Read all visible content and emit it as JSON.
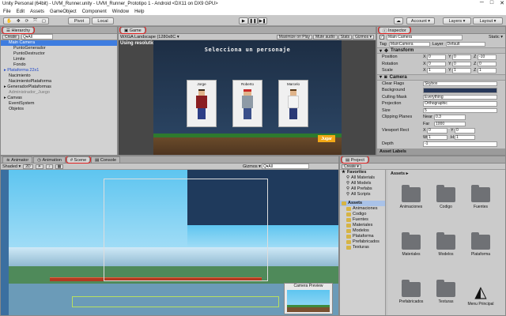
{
  "window": {
    "title": "Unity Personal (64bit) - UVM_Runner.unity - UVM_Runner_Prototipo 1 - Android <DX11 on DX9 GPU>",
    "controls": [
      "─",
      "□",
      "✕"
    ]
  },
  "menu": [
    "File",
    "Edit",
    "Assets",
    "GameObject",
    "Component",
    "Window",
    "Help"
  ],
  "toolbar": {
    "pivot": "Pivot",
    "local": "Local",
    "account": "Account",
    "layers": "Layers",
    "layout": "Layout",
    "cloud": "☁"
  },
  "hierarchy": {
    "tab": "Hierarchy",
    "create": "Create",
    "search": "Q▾All",
    "items": [
      {
        "label": "Main Camera",
        "indent": 1,
        "sel": true
      },
      {
        "label": "PuntoGenerador",
        "indent": 2
      },
      {
        "label": "PuntoDestructor",
        "indent": 2
      },
      {
        "label": "Limite",
        "indent": 2
      },
      {
        "label": "Fondo",
        "indent": 2
      },
      {
        "label": "▸ Plataforma 22x1",
        "indent": 0,
        "blue": true
      },
      {
        "label": "Nacimiento",
        "indent": 1
      },
      {
        "label": "NacimientoPlataforma",
        "indent": 1
      },
      {
        "label": "▸ GeneradorPlataformas",
        "indent": 0
      },
      {
        "label": "Administrador_Juego",
        "indent": 1,
        "gray": true
      },
      {
        "label": "▸ Canvas",
        "indent": 0
      },
      {
        "label": "EventSystem",
        "indent": 1
      },
      {
        "label": "Objetos",
        "indent": 1
      }
    ]
  },
  "game": {
    "tab": "Game",
    "aspect": "WXGA Landscape (1280x8C ▾",
    "options": [
      "Maximize on Play",
      "Mute audio",
      "Stats",
      "Gizmos ▾"
    ],
    "resolution": "Using resolution 531x332",
    "heading": "Selecciona un personaje",
    "chars": [
      "Jorge",
      "Roberto",
      "Marcelo"
    ],
    "button": "Jugar"
  },
  "inspector": {
    "tab": "Inspector",
    "object": "Main Camera",
    "static": "Static ▾",
    "tag_label": "Tag",
    "tag": "MainCamera",
    "layer_label": "Layer",
    "layer": "Default",
    "transform": {
      "title": "Transform",
      "rows": [
        {
          "label": "Position",
          "x": "0",
          "y": "0",
          "z": "-10"
        },
        {
          "label": "Rotation",
          "x": "0",
          "y": "0",
          "z": "0"
        },
        {
          "label": "Scale",
          "x": "1",
          "y": "1",
          "z": "1"
        }
      ]
    },
    "camera": {
      "title": "Camera",
      "clear_flags_label": "Clear Flags",
      "clear_flags": "Skybox",
      "background_label": "Background",
      "culling_label": "Culling Mask",
      "culling": "Everything",
      "projection_label": "Projection",
      "projection": "Orthographic",
      "size_label": "Size",
      "size": "5",
      "clip_label": "Clipping Planes",
      "near_label": "Near",
      "near": "0.3",
      "far_label": "Far",
      "far": "1000",
      "viewport_label": "Viewport Rect",
      "vx": "0",
      "vy": "0",
      "vw": "1",
      "vh": "1",
      "depth_label": "Depth",
      "depth": "-1"
    },
    "asset_labels": "Asset Labels"
  },
  "scene": {
    "tabs": [
      "Animator",
      "Animation",
      "Scene",
      "Console"
    ],
    "shading": "Shaded ▾",
    "mode2d": "2D",
    "gizmos": "Gizmos ▾",
    "search": "Q▾All",
    "preview": "Camera Preview"
  },
  "project": {
    "tab": "Project",
    "create": "Create ▾",
    "favorites": {
      "title": "Favorites",
      "items": [
        "All Materials",
        "All Models",
        "All Prefabs",
        "All Scripts"
      ]
    },
    "assets": {
      "title": "Assets",
      "items": [
        "Animaciones",
        "Codigo",
        "Fuentes",
        "Materiales",
        "Modelos",
        "Plataforma",
        "Prefabricados",
        "Texturas"
      ]
    },
    "breadcrumb": "Assets ▸",
    "grid": [
      "Animaciones",
      "Codigo",
      "Fuentes",
      "Materiales",
      "Modelos",
      "Plataforma",
      "Prefabricados",
      "Texturas",
      "Menu Principal"
    ]
  },
  "colors": {
    "highlight": "#e02020",
    "selection": "#3e7de0",
    "folder": "#6f7175"
  }
}
